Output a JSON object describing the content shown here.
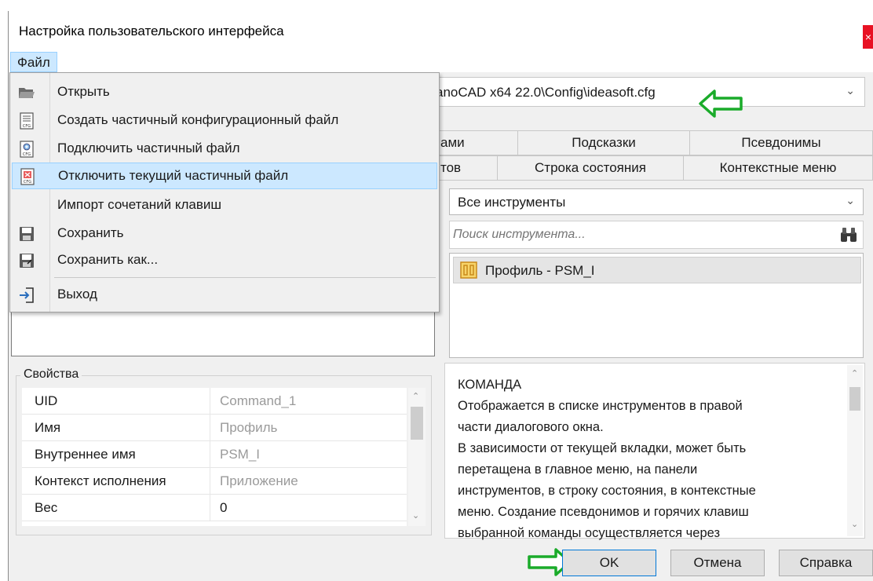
{
  "window": {
    "title": "Настройка пользовательского интерфейса",
    "close_glyph": "×"
  },
  "menubar": {
    "file_label": "Файл"
  },
  "file_menu": {
    "items": [
      {
        "label": "Открыть",
        "icon": "folder-open-icon"
      },
      {
        "label": "Создать частичный конфигурационный файл",
        "icon": "cfg-new-icon"
      },
      {
        "label": "Подключить частичный файл",
        "icon": "cfg-attach-icon"
      },
      {
        "label": "Отключить текущий частичный файл",
        "icon": "cfg-detach-icon"
      },
      {
        "label": "Импорт сочетаний клавиш",
        "icon": ""
      },
      {
        "label": "Сохранить",
        "icon": "floppy-icon"
      },
      {
        "label": "Сохранить как...",
        "icon": "floppy-saveas-icon"
      },
      {
        "label": "Выход",
        "icon": "exit-icon"
      }
    ],
    "highlighted_index": 3
  },
  "config_path": {
    "value": "anoCAD x64 22.0\\Config\\ideasoft.cfg"
  },
  "tabs_row1": [
    "ами",
    "Подсказки",
    "Псевдонимы"
  ],
  "tabs_row2": [
    "тов",
    "Строка состояния",
    "Контекстные меню"
  ],
  "tools": {
    "filter_value": "Все инструменты",
    "search_placeholder": "Поиск инструмента...",
    "items": [
      {
        "label": "Профиль - PSM_I"
      }
    ]
  },
  "properties": {
    "legend": "Свойства",
    "rows": [
      {
        "key": "UID",
        "value": "Command_1"
      },
      {
        "key": "Имя",
        "value": "Профиль"
      },
      {
        "key": "Внутреннее имя",
        "value": "PSM_I"
      },
      {
        "key": "Контекст исполнения",
        "value": "Приложение"
      },
      {
        "key": "Вес",
        "value": "0"
      }
    ]
  },
  "description": {
    "heading": "КОМАНДА",
    "lines": [
      "Отображается в списке инструментов в правой",
      "части диалогового окна.",
      "В зависимости от текущей вкладки, может быть",
      "перетащена в главное меню, на панели",
      "инструментов, в строку состояния, в контекстные",
      "меню. Создание псевдонимов и горячих клавиш",
      "выбранной команды осуществляется через"
    ]
  },
  "buttons": {
    "ok": "OK",
    "cancel": "Отмена",
    "help": "Справка"
  },
  "colors": {
    "highlight": "#cce8ff",
    "arrow_green": "#1aab2a",
    "close_red": "#e81123"
  }
}
